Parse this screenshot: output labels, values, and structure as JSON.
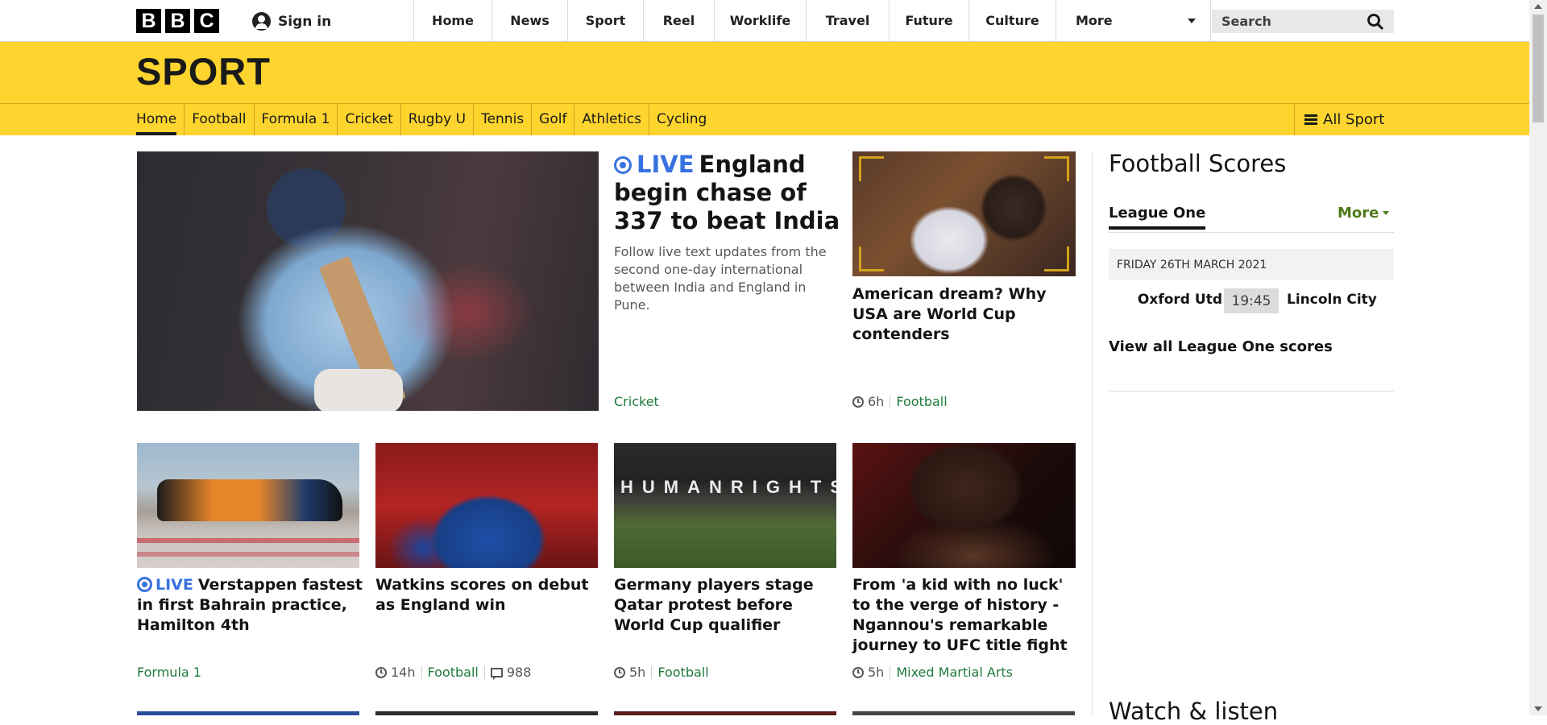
{
  "masthead": {
    "logo_letters": [
      "B",
      "B",
      "C"
    ],
    "signin_label": "Sign in",
    "nav": [
      {
        "label": "Home"
      },
      {
        "label": "News"
      },
      {
        "label": "Sport"
      },
      {
        "label": "Reel"
      },
      {
        "label": "Worklife"
      },
      {
        "label": "Travel"
      },
      {
        "label": "Future"
      },
      {
        "label": "Culture"
      }
    ],
    "more_label": "More",
    "search_placeholder": "Search"
  },
  "sport": {
    "title": "SPORT",
    "nav": [
      "Home",
      "Football",
      "Formula 1",
      "Cricket",
      "Rugby U",
      "Tennis",
      "Golf",
      "Athletics",
      "Cycling"
    ],
    "all_sport_label": "All Sport",
    "accent_color": "#fed42e"
  },
  "live_color": "#3872e0",
  "topic_color": "#1f7a3c",
  "hero": {
    "live_label": "LIVE",
    "title": "England begin chase of 337 to beat India",
    "summary": "Follow live text updates from the second one-day international between India and England in Pune.",
    "topic": "Cricket"
  },
  "usa_story": {
    "title": "American dream? Why USA are World Cup contenders",
    "age": "6h",
    "topic": "Football"
  },
  "row2": [
    {
      "live_label": "LIVE",
      "title": "Verstappen fastest in first Bahrain practice, Hamilton 4th",
      "topic": "Formula 1"
    },
    {
      "title": "Watkins scores on debut as England win",
      "age": "14h",
      "topic": "Football",
      "comments": "988"
    },
    {
      "title": "Germany players stage Qatar protest before World Cup qualifier",
      "age": "5h",
      "topic": "Football",
      "photo_text": "HUMANRIGHTS"
    },
    {
      "title": "From 'a kid with no luck' to the verge of history - Ngannou's remarkable journey to UFC title fight",
      "age": "5h",
      "topic": "Mixed Martial Arts"
    }
  ],
  "scores": {
    "title": "Football Scores",
    "league_tab": "League One",
    "more_label": "More",
    "date": "FRIDAY 26TH MARCH 2021",
    "fixture": {
      "home": "Oxford Utd",
      "time": "19:45",
      "away": "Lincoln City"
    },
    "view_all": "View all League One scores"
  },
  "watch_heading": "Watch & listen"
}
